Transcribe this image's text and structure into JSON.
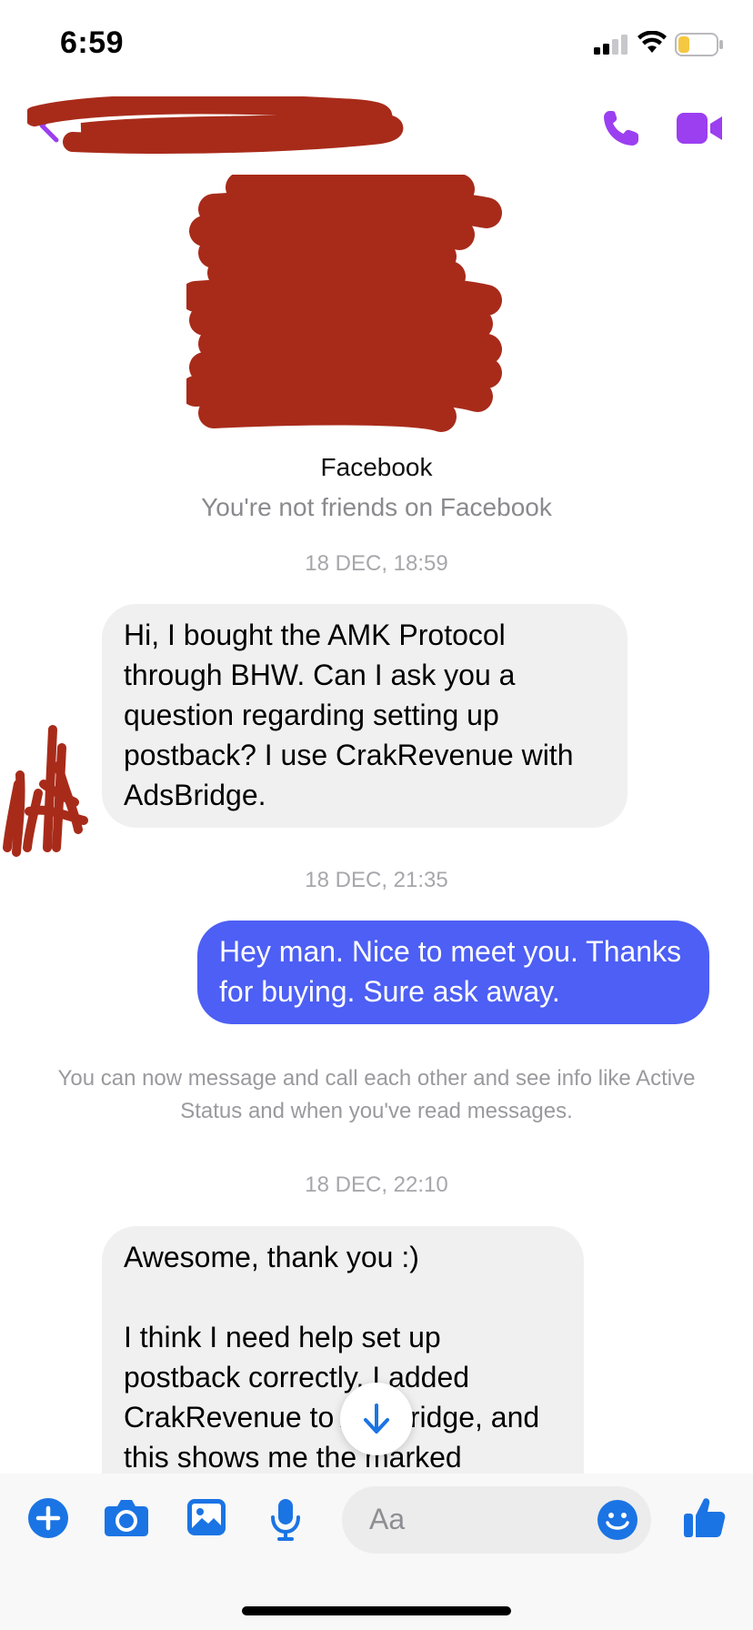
{
  "status": {
    "time": "6:59",
    "battery_color": "#f5c842"
  },
  "header": {
    "back_icon": "chevron-left-icon",
    "call_icon": "phone-icon",
    "video_icon": "video-camera-icon",
    "accent_color": "#9b3ff0"
  },
  "profile": {
    "platform_label": "Facebook",
    "friend_status": "You're not friends on Facebook"
  },
  "thread": {
    "timestamp_1": "18 DEC, 18:59",
    "message_1": "Hi, I bought the AMK Protocol through BHW. Can I ask you a question regarding setting up postback? I use CrakRevenue with AdsBridge.",
    "timestamp_2": "18 DEC, 21:35",
    "message_2": "Hey man. Nice to meet you. Thanks for buying. Sure ask away.",
    "info_notice": "You can now message and call each other and see info like Active Status and when you've read messages.",
    "timestamp_3": "18 DEC, 22:10",
    "message_3": "Awesome, thank you :)\n\nI think I need help set up postback correctly. I added CrakRevenue to AdsBridge, and this shows me the marked",
    "incoming_bubble_color": "#f0f0f0",
    "outgoing_bubble_color": "#4d5ff4",
    "scroll_icon": "arrow-down-icon"
  },
  "composer": {
    "placeholder": "Aa",
    "icons": [
      "plus-icon",
      "camera-icon",
      "photo-icon",
      "microphone-icon",
      "emoji-icon",
      "thumbs-up-icon"
    ],
    "icon_color": "#1b74e4"
  },
  "redaction_color": "#a82b1a"
}
